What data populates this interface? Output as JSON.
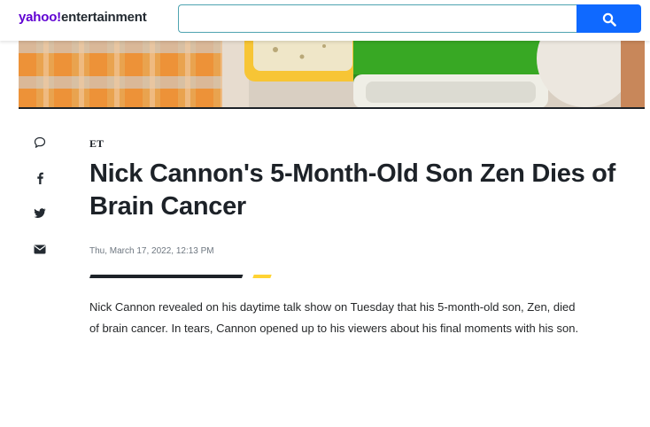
{
  "header": {
    "logo_brand": "yahoo!",
    "logo_section": "entertainment",
    "search": {
      "value": "",
      "placeholder": ""
    }
  },
  "share_rail": {
    "items": [
      {
        "icon": "comment-icon"
      },
      {
        "icon": "facebook-icon"
      },
      {
        "icon": "twitter-icon"
      },
      {
        "icon": "email-icon"
      }
    ]
  },
  "article": {
    "provider": "ET",
    "headline": "Nick Cannon's 5-Month-Old Son Zen Dies of Brain Cancer",
    "date": "Thu, March 17, 2022, 12:13 PM",
    "body": "Nick Cannon revealed on his daytime talk show on Tuesday that his 5-month-old son, Zen, died of brain cancer. In tears, Cannon opened up to his viewers about his final moments with his son."
  },
  "colors": {
    "brand_purple": "#6001d2",
    "search_blue": "#0f69ff",
    "accent_yellow": "#ffd333",
    "text_dark": "#1d2228"
  }
}
